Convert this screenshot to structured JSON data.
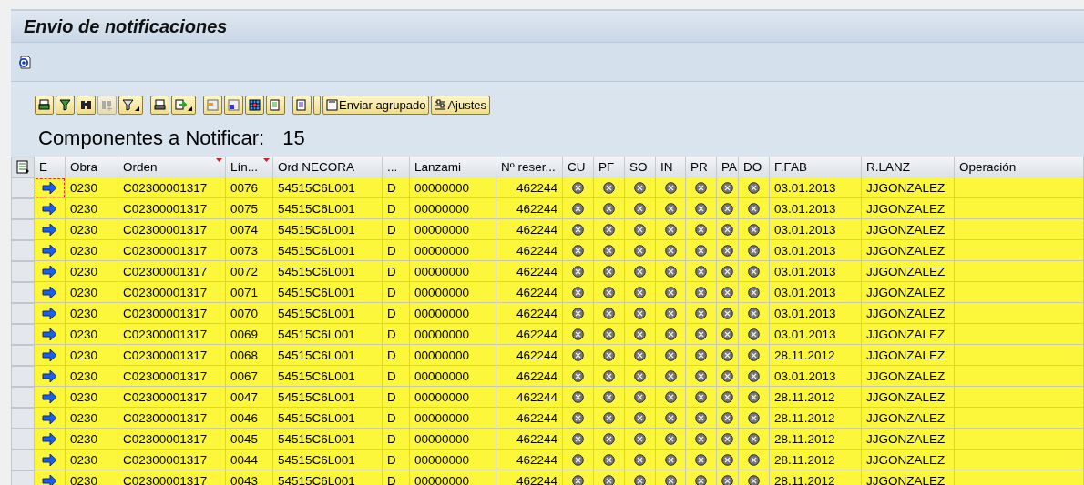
{
  "window": {
    "title": "Envio de notificaciones"
  },
  "app_toolbar": {
    "refresh_enabled": true
  },
  "alv_toolbar": {
    "groups": [
      [
        {
          "kind": "icon",
          "disabled": false,
          "dropdown": false
        },
        {
          "kind": "icon",
          "disabled": false,
          "dropdown": false
        },
        {
          "kind": "icon",
          "disabled": false,
          "dropdown": false
        },
        {
          "kind": "icon",
          "disabled": true,
          "dropdown": false
        },
        {
          "kind": "icon",
          "disabled": false,
          "dropdown": true
        }
      ],
      [
        {
          "kind": "icon",
          "disabled": false,
          "dropdown": false
        },
        {
          "kind": "icon",
          "disabled": false,
          "dropdown": true
        }
      ],
      [
        {
          "kind": "icon",
          "disabled": false,
          "dropdown": false
        },
        {
          "kind": "icon",
          "disabled": false,
          "dropdown": false
        },
        {
          "kind": "icon",
          "disabled": false,
          "dropdown": false
        },
        {
          "kind": "icon",
          "disabled": false,
          "dropdown": false
        }
      ],
      [
        {
          "kind": "icon",
          "disabled": false,
          "dropdown": false
        },
        {
          "kind": "spacer",
          "disabled": false,
          "dropdown": false
        },
        {
          "kind": "text",
          "label": "Enviar agrupado",
          "disabled": false,
          "dropdown": false
        },
        {
          "kind": "text",
          "label": "Ajustes",
          "disabled": false,
          "dropdown": false
        }
      ]
    ]
  },
  "heading": {
    "label": "Componentes a Notificar:",
    "count": "15"
  },
  "table": {
    "columns": [
      {
        "label": "E",
        "sorted": false
      },
      {
        "label": "Obra",
        "sorted": false
      },
      {
        "label": "Orden",
        "sorted": true
      },
      {
        "label": "Lín...",
        "sorted": true
      },
      {
        "label": "Ord NECORA",
        "sorted": false
      },
      {
        "label": "...",
        "sorted": false
      },
      {
        "label": "Lanzami",
        "sorted": false
      },
      {
        "label": "Nº reser...",
        "sorted": false
      },
      {
        "label": "CU",
        "sorted": false
      },
      {
        "label": "PF",
        "sorted": false
      },
      {
        "label": "SO",
        "sorted": false
      },
      {
        "label": "IN",
        "sorted": false
      },
      {
        "label": "PR",
        "sorted": false
      },
      {
        "label": "PA",
        "sorted": false
      },
      {
        "label": "DO",
        "sorted": false
      },
      {
        "label": "F.FAB",
        "sorted": false
      },
      {
        "label": "R.LANZ",
        "sorted": false
      },
      {
        "label": "Operación",
        "sorted": false
      }
    ],
    "rows": [
      {
        "focused": true,
        "obra": "0230",
        "orden": "C02300001317",
        "lin": "0076",
        "necora": "54515C6L001",
        "flag": "D",
        "lanzami": "00000000",
        "reserva": "462244",
        "ffab": "03.01.2013",
        "rlanz": "JJGONZALEZ"
      },
      {
        "focused": false,
        "obra": "0230",
        "orden": "C02300001317",
        "lin": "0075",
        "necora": "54515C6L001",
        "flag": "D",
        "lanzami": "00000000",
        "reserva": "462244",
        "ffab": "03.01.2013",
        "rlanz": "JJGONZALEZ"
      },
      {
        "focused": false,
        "obra": "0230",
        "orden": "C02300001317",
        "lin": "0074",
        "necora": "54515C6L001",
        "flag": "D",
        "lanzami": "00000000",
        "reserva": "462244",
        "ffab": "03.01.2013",
        "rlanz": "JJGONZALEZ"
      },
      {
        "focused": false,
        "obra": "0230",
        "orden": "C02300001317",
        "lin": "0073",
        "necora": "54515C6L001",
        "flag": "D",
        "lanzami": "00000000",
        "reserva": "462244",
        "ffab": "03.01.2013",
        "rlanz": "JJGONZALEZ"
      },
      {
        "focused": false,
        "obra": "0230",
        "orden": "C02300001317",
        "lin": "0072",
        "necora": "54515C6L001",
        "flag": "D",
        "lanzami": "00000000",
        "reserva": "462244",
        "ffab": "03.01.2013",
        "rlanz": "JJGONZALEZ"
      },
      {
        "focused": false,
        "obra": "0230",
        "orden": "C02300001317",
        "lin": "0071",
        "necora": "54515C6L001",
        "flag": "D",
        "lanzami": "00000000",
        "reserva": "462244",
        "ffab": "03.01.2013",
        "rlanz": "JJGONZALEZ"
      },
      {
        "focused": false,
        "obra": "0230",
        "orden": "C02300001317",
        "lin": "0070",
        "necora": "54515C6L001",
        "flag": "D",
        "lanzami": "00000000",
        "reserva": "462244",
        "ffab": "03.01.2013",
        "rlanz": "JJGONZALEZ"
      },
      {
        "focused": false,
        "obra": "0230",
        "orden": "C02300001317",
        "lin": "0069",
        "necora": "54515C6L001",
        "flag": "D",
        "lanzami": "00000000",
        "reserva": "462244",
        "ffab": "03.01.2013",
        "rlanz": "JJGONZALEZ"
      },
      {
        "focused": false,
        "obra": "0230",
        "orden": "C02300001317",
        "lin": "0068",
        "necora": "54515C6L001",
        "flag": "D",
        "lanzami": "00000000",
        "reserva": "462244",
        "ffab": "28.11.2012",
        "rlanz": "JJGONZALEZ"
      },
      {
        "focused": false,
        "obra": "0230",
        "orden": "C02300001317",
        "lin": "0067",
        "necora": "54515C6L001",
        "flag": "D",
        "lanzami": "00000000",
        "reserva": "462244",
        "ffab": "03.01.2013",
        "rlanz": "JJGONZALEZ"
      },
      {
        "focused": false,
        "obra": "0230",
        "orden": "C02300001317",
        "lin": "0047",
        "necora": "54515C6L001",
        "flag": "D",
        "lanzami": "00000000",
        "reserva": "462244",
        "ffab": "28.11.2012",
        "rlanz": "JJGONZALEZ"
      },
      {
        "focused": false,
        "obra": "0230",
        "orden": "C02300001317",
        "lin": "0046",
        "necora": "54515C6L001",
        "flag": "D",
        "lanzami": "00000000",
        "reserva": "462244",
        "ffab": "28.11.2012",
        "rlanz": "JJGONZALEZ"
      },
      {
        "focused": false,
        "obra": "0230",
        "orden": "C02300001317",
        "lin": "0045",
        "necora": "54515C6L001",
        "flag": "D",
        "lanzami": "00000000",
        "reserva": "462244",
        "ffab": "28.11.2012",
        "rlanz": "JJGONZALEZ"
      },
      {
        "focused": false,
        "obra": "0230",
        "orden": "C02300001317",
        "lin": "0044",
        "necora": "54515C6L001",
        "flag": "D",
        "lanzami": "00000000",
        "reserva": "462244",
        "ffab": "28.11.2012",
        "rlanz": "JJGONZALEZ"
      },
      {
        "focused": false,
        "obra": "0230",
        "orden": "C02300001317",
        "lin": "0043",
        "necora": "54515C6L001",
        "flag": "D",
        "lanzami": "00000000",
        "reserva": "462244",
        "ffab": "28.11.2012",
        "rlanz": "JJGONZALEZ"
      }
    ]
  }
}
